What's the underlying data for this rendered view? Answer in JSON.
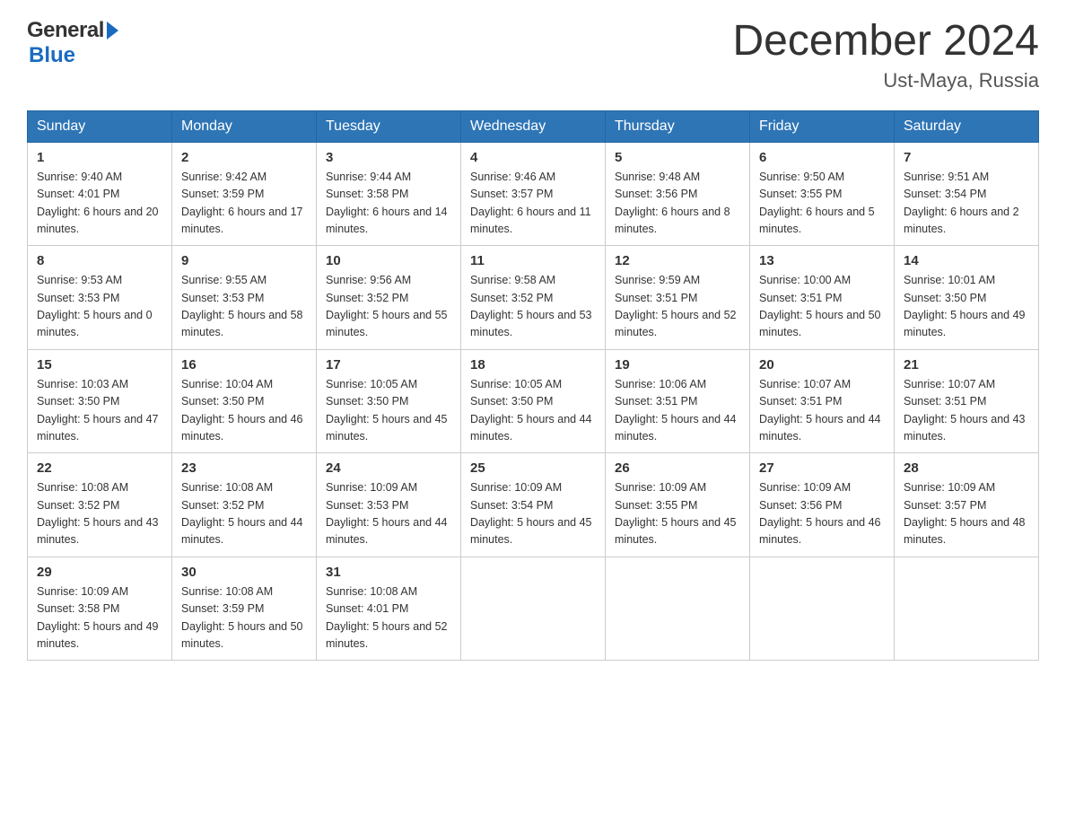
{
  "header": {
    "logo_general": "General",
    "logo_blue": "Blue",
    "title": "December 2024",
    "subtitle": "Ust-Maya, Russia"
  },
  "days_of_week": [
    "Sunday",
    "Monday",
    "Tuesday",
    "Wednesday",
    "Thursday",
    "Friday",
    "Saturday"
  ],
  "weeks": [
    [
      {
        "day": "1",
        "sunrise": "9:40 AM",
        "sunset": "4:01 PM",
        "daylight": "6 hours and 20 minutes."
      },
      {
        "day": "2",
        "sunrise": "9:42 AM",
        "sunset": "3:59 PM",
        "daylight": "6 hours and 17 minutes."
      },
      {
        "day": "3",
        "sunrise": "9:44 AM",
        "sunset": "3:58 PM",
        "daylight": "6 hours and 14 minutes."
      },
      {
        "day": "4",
        "sunrise": "9:46 AM",
        "sunset": "3:57 PM",
        "daylight": "6 hours and 11 minutes."
      },
      {
        "day": "5",
        "sunrise": "9:48 AM",
        "sunset": "3:56 PM",
        "daylight": "6 hours and 8 minutes."
      },
      {
        "day": "6",
        "sunrise": "9:50 AM",
        "sunset": "3:55 PM",
        "daylight": "6 hours and 5 minutes."
      },
      {
        "day": "7",
        "sunrise": "9:51 AM",
        "sunset": "3:54 PM",
        "daylight": "6 hours and 2 minutes."
      }
    ],
    [
      {
        "day": "8",
        "sunrise": "9:53 AM",
        "sunset": "3:53 PM",
        "daylight": "5 hours and 0 minutes."
      },
      {
        "day": "9",
        "sunrise": "9:55 AM",
        "sunset": "3:53 PM",
        "daylight": "5 hours and 58 minutes."
      },
      {
        "day": "10",
        "sunrise": "9:56 AM",
        "sunset": "3:52 PM",
        "daylight": "5 hours and 55 minutes."
      },
      {
        "day": "11",
        "sunrise": "9:58 AM",
        "sunset": "3:52 PM",
        "daylight": "5 hours and 53 minutes."
      },
      {
        "day": "12",
        "sunrise": "9:59 AM",
        "sunset": "3:51 PM",
        "daylight": "5 hours and 52 minutes."
      },
      {
        "day": "13",
        "sunrise": "10:00 AM",
        "sunset": "3:51 PM",
        "daylight": "5 hours and 50 minutes."
      },
      {
        "day": "14",
        "sunrise": "10:01 AM",
        "sunset": "3:50 PM",
        "daylight": "5 hours and 49 minutes."
      }
    ],
    [
      {
        "day": "15",
        "sunrise": "10:03 AM",
        "sunset": "3:50 PM",
        "daylight": "5 hours and 47 minutes."
      },
      {
        "day": "16",
        "sunrise": "10:04 AM",
        "sunset": "3:50 PM",
        "daylight": "5 hours and 46 minutes."
      },
      {
        "day": "17",
        "sunrise": "10:05 AM",
        "sunset": "3:50 PM",
        "daylight": "5 hours and 45 minutes."
      },
      {
        "day": "18",
        "sunrise": "10:05 AM",
        "sunset": "3:50 PM",
        "daylight": "5 hours and 44 minutes."
      },
      {
        "day": "19",
        "sunrise": "10:06 AM",
        "sunset": "3:51 PM",
        "daylight": "5 hours and 44 minutes."
      },
      {
        "day": "20",
        "sunrise": "10:07 AM",
        "sunset": "3:51 PM",
        "daylight": "5 hours and 44 minutes."
      },
      {
        "day": "21",
        "sunrise": "10:07 AM",
        "sunset": "3:51 PM",
        "daylight": "5 hours and 43 minutes."
      }
    ],
    [
      {
        "day": "22",
        "sunrise": "10:08 AM",
        "sunset": "3:52 PM",
        "daylight": "5 hours and 43 minutes."
      },
      {
        "day": "23",
        "sunrise": "10:08 AM",
        "sunset": "3:52 PM",
        "daylight": "5 hours and 44 minutes."
      },
      {
        "day": "24",
        "sunrise": "10:09 AM",
        "sunset": "3:53 PM",
        "daylight": "5 hours and 44 minutes."
      },
      {
        "day": "25",
        "sunrise": "10:09 AM",
        "sunset": "3:54 PM",
        "daylight": "5 hours and 45 minutes."
      },
      {
        "day": "26",
        "sunrise": "10:09 AM",
        "sunset": "3:55 PM",
        "daylight": "5 hours and 45 minutes."
      },
      {
        "day": "27",
        "sunrise": "10:09 AM",
        "sunset": "3:56 PM",
        "daylight": "5 hours and 46 minutes."
      },
      {
        "day": "28",
        "sunrise": "10:09 AM",
        "sunset": "3:57 PM",
        "daylight": "5 hours and 48 minutes."
      }
    ],
    [
      {
        "day": "29",
        "sunrise": "10:09 AM",
        "sunset": "3:58 PM",
        "daylight": "5 hours and 49 minutes."
      },
      {
        "day": "30",
        "sunrise": "10:08 AM",
        "sunset": "3:59 PM",
        "daylight": "5 hours and 50 minutes."
      },
      {
        "day": "31",
        "sunrise": "10:08 AM",
        "sunset": "4:01 PM",
        "daylight": "5 hours and 52 minutes."
      },
      null,
      null,
      null,
      null
    ]
  ],
  "labels": {
    "sunrise": "Sunrise:",
    "sunset": "Sunset:",
    "daylight": "Daylight:"
  }
}
